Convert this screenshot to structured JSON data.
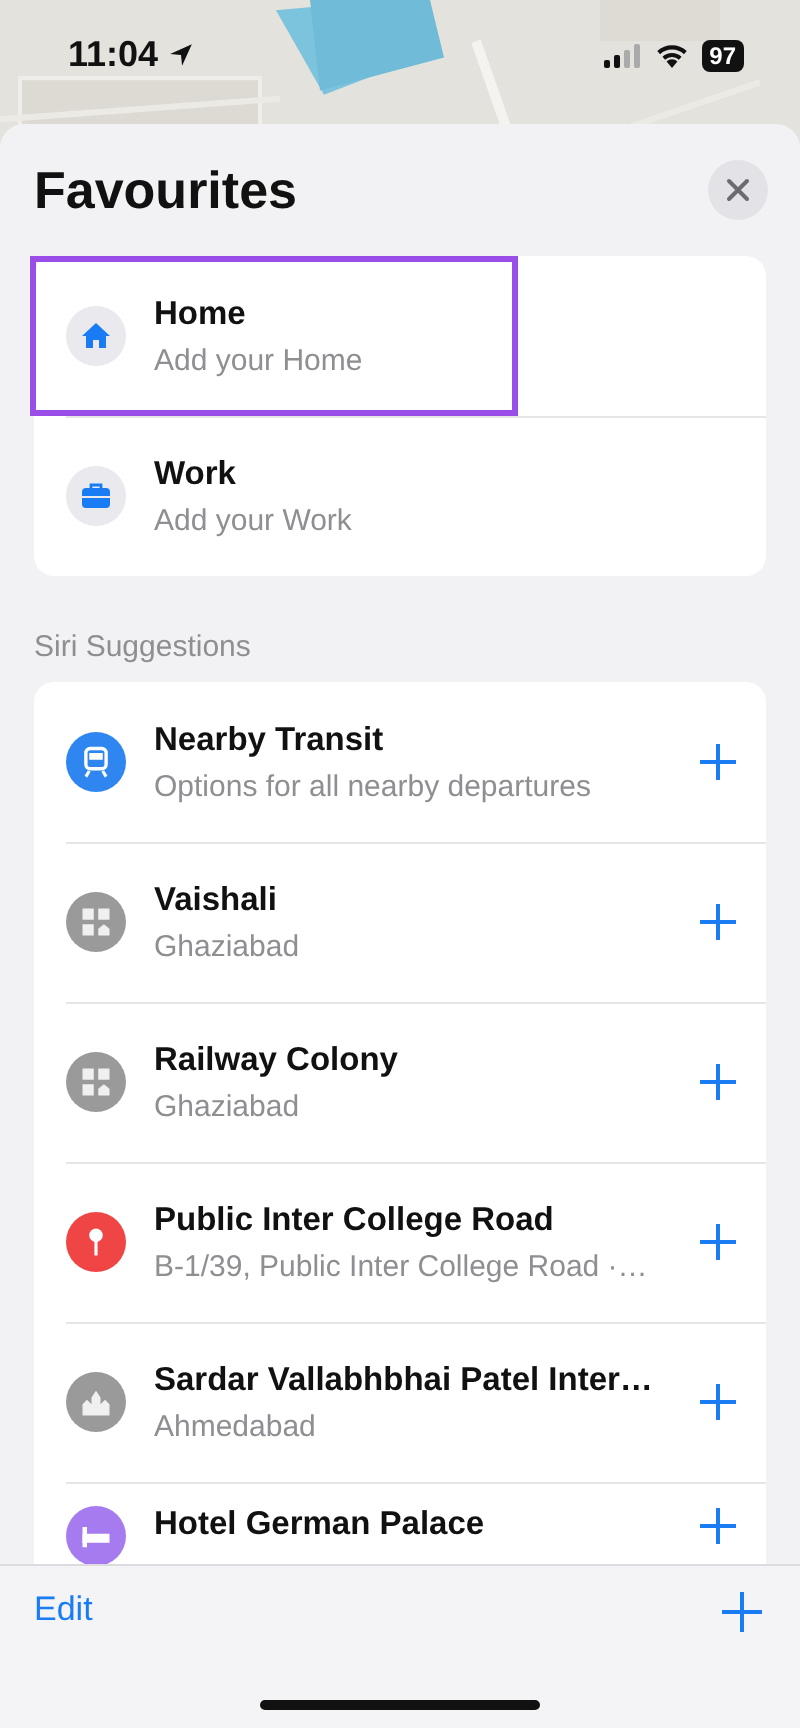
{
  "status_bar": {
    "time": "11:04",
    "battery": "97"
  },
  "sheet": {
    "title": "Favourites"
  },
  "favourites": [
    {
      "kind": "home",
      "title": "Home",
      "subtitle": "Add your Home",
      "highlighted": true
    },
    {
      "kind": "work",
      "title": "Work",
      "subtitle": "Add your Work",
      "highlighted": false
    }
  ],
  "suggestions_heading": "Siri Suggestions",
  "suggestions": [
    {
      "kind": "transit",
      "color": "#2f86f0",
      "title": "Nearby Transit",
      "subtitle": "Options for all nearby departures"
    },
    {
      "kind": "area",
      "color": "#9a9a9a",
      "title": "Vaishali",
      "subtitle": "Ghaziabad"
    },
    {
      "kind": "area",
      "color": "#9a9a9a",
      "title": "Railway Colony",
      "subtitle": "Ghaziabad"
    },
    {
      "kind": "pin",
      "color": "#f04545",
      "title": "Public Inter College Road",
      "subtitle": "B-1/39, Public Inter College Road ·…"
    },
    {
      "kind": "landmark",
      "color": "#9a9a9a",
      "title": "Sardar Vallabhbhai Patel Inter…",
      "subtitle": "Ahmedabad"
    },
    {
      "kind": "hotel",
      "color": "#a77bf0",
      "title": "Hotel German Palace"
    }
  ],
  "toolbar": {
    "edit": "Edit"
  }
}
